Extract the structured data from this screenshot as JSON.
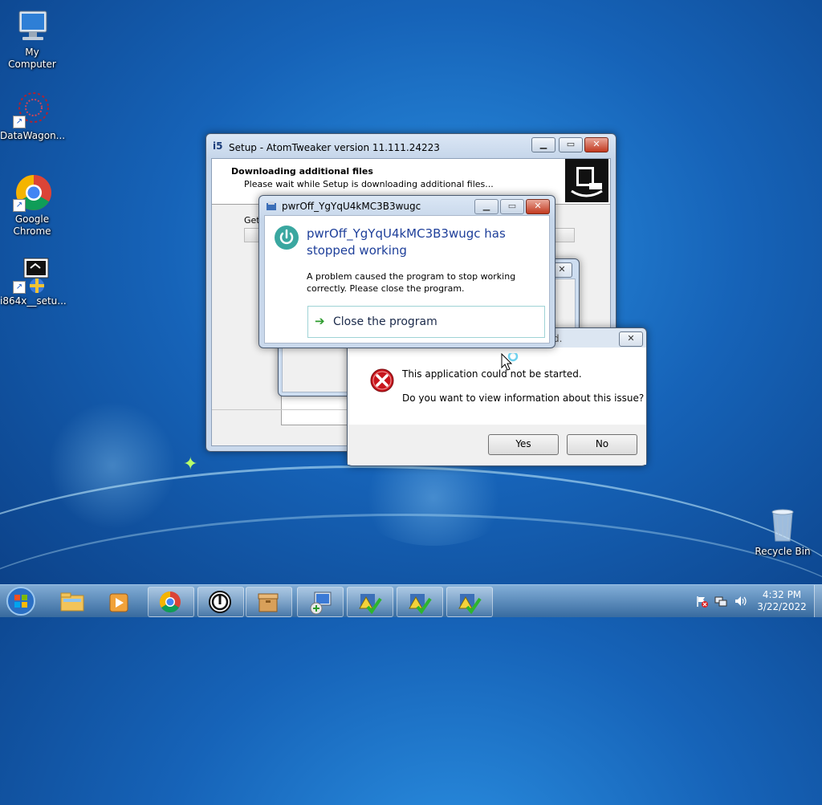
{
  "desktop": {
    "icons": [
      {
        "label": "My Computer"
      },
      {
        "label": "DataWagon..."
      },
      {
        "label": "Google Chrome"
      },
      {
        "label": "i864x__setu..."
      },
      {
        "label": "Recycle Bin"
      }
    ]
  },
  "setup_window": {
    "title": "Setup - AtomTweaker version 11.111.24223",
    "heading": "Downloading additional files",
    "subheading": "Please wait while Setup is downloading additional files...",
    "status_label": "Get"
  },
  "crash_dialog": {
    "title": "pwrOff_YgYqU4kMC3B3wugc",
    "headline": "pwrOff_YgYqU4kMC3B3wugc has stopped working",
    "message": "A problem caused the program to stop working correctly. Please close the program.",
    "close_option": "Close the program"
  },
  "error_dialog": {
    "title_fragment": "d.",
    "line1": "This application could not be started.",
    "line2": "Do you want to view information about this issue?",
    "yes_label": "Yes",
    "no_label": "No"
  },
  "taskbar": {
    "clock_time": "4:32 PM",
    "clock_date": "3/22/2022"
  },
  "colors": {
    "accent": "#1663b8",
    "crash_heading": "#1e3f9a",
    "error_red": "#c8161d"
  }
}
